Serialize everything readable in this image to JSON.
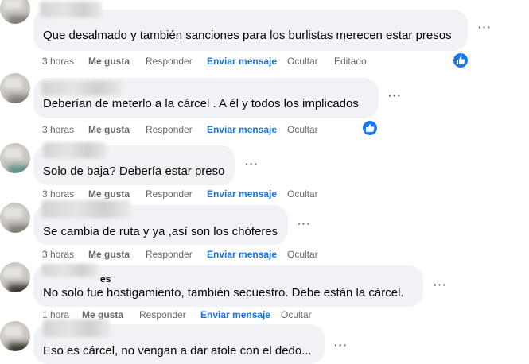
{
  "comments": [
    {
      "text": "Que desalmado y también sanciones para los burlistas merecen estar presos",
      "more": "···",
      "actions": {
        "time": "3 horas",
        "like": "Me gusta",
        "reply": "Responder",
        "message": "Enviar mensaje",
        "hide": "Ocultar",
        "edited": "Editado"
      },
      "reaction": "like-icon"
    },
    {
      "text": "Deberían de meterlo a la cárcel . A él y todos los implicados",
      "more": "···",
      "actions": {
        "time": "3 horas",
        "like": "Me gusta",
        "reply": "Responder",
        "message": "Enviar mensaje",
        "hide": "Ocultar"
      },
      "reaction": "like-icon"
    },
    {
      "text": "Solo de baja? Debería estar preso",
      "more": "···",
      "actions": {
        "time": "3 horas",
        "like": "Me gusta",
        "reply": "Responder",
        "message": "Enviar mensaje",
        "hide": "Ocultar"
      }
    },
    {
      "text": "Se cambia de ruta y ya ,así son los chóferes",
      "more": "···",
      "actions": {
        "time": "3 horas",
        "like": "Me gusta",
        "reply": "Responder",
        "message": "Enviar mensaje",
        "hide": "Ocultar"
      }
    },
    {
      "name_tail": "es",
      "text": "No solo fue hostigamiento, también secuestro. Debe están la cárcel.",
      "more": "···",
      "actions": {
        "time": "1 hora",
        "like": "Me gusta",
        "reply": "Responder",
        "message": "Enviar mensaje",
        "hide": "Ocultar"
      }
    },
    {
      "text": "Eso es cárcel, no vengan a dar atole con el dedo...",
      "more": "···"
    }
  ],
  "colors": {
    "bubble": "#f0f2f5",
    "action_blue": "#1b74e4",
    "like_badge": "#1877f2",
    "meta_gray": "#65676b"
  }
}
